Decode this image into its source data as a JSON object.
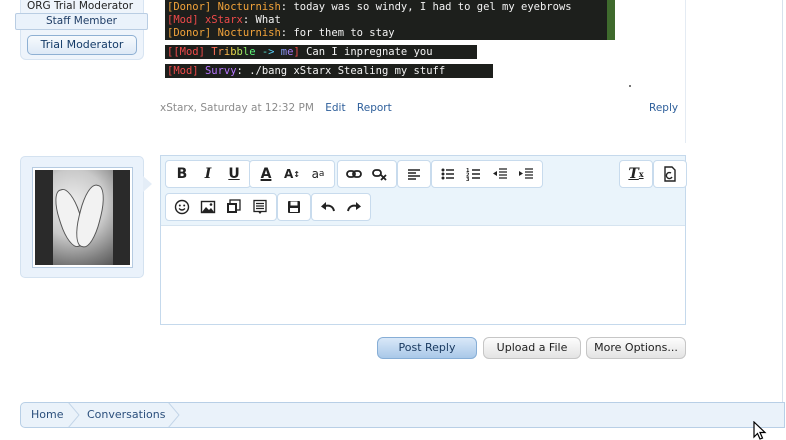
{
  "top_user": {
    "title_line": "ORG Trial Moderator",
    "staff_badge": "Staff Member",
    "role_badge": "Trial Moderator"
  },
  "chat_screenshot": {
    "lines": [
      {
        "prefix": "[Donor] ",
        "name": "Nocturnish",
        "text": ": today was so windy, I had to gel my eyebrows"
      },
      {
        "prefix": "[Mod] ",
        "name": "xStarx",
        "text": ": What"
      },
      {
        "prefix": "[Donor] ",
        "name": "Nocturnish",
        "text": ": for them to stay"
      }
    ],
    "strip1": {
      "prefix": "[[Mod] ",
      "name": "Tribble -> me",
      "suffix": "] ",
      "text": "Can I inpregnate you"
    },
    "strip2": {
      "prefix": "[Mod] ",
      "name": "Survy",
      "text": ": ./bang xStarx Stealing my stuff"
    }
  },
  "message_meta": {
    "author_time": "xStarx, Saturday at 12:32 PM",
    "edit": "Edit",
    "report": "Report",
    "reply": "Reply"
  },
  "editor": {
    "bold": "B",
    "italic": "I",
    "underline": "U",
    "font_color": "A",
    "font_size": "A",
    "font_family": "a",
    "remove_format": "T"
  },
  "buttons": {
    "post_reply": "Post Reply",
    "upload_file": "Upload a File",
    "more_options": "More Options..."
  },
  "breadcrumb": {
    "home": "Home",
    "conversations": "Conversations"
  }
}
